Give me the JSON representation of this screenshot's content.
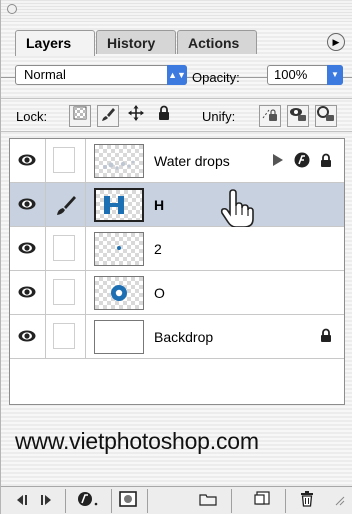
{
  "tabs": [
    {
      "label": "Layers",
      "active": true
    },
    {
      "label": "History",
      "active": false
    },
    {
      "label": "Actions",
      "active": false
    }
  ],
  "blend_mode": "Normal",
  "opacity": {
    "label": "Opacity:",
    "value": "100%"
  },
  "lock": {
    "label": "Lock:"
  },
  "unify": {
    "label": "Unify:"
  },
  "layers": [
    {
      "name": "Water drops",
      "visible": true,
      "selected": false,
      "thumb": "drops",
      "right_icons": [
        "expand-triangle-icon",
        "fx-icon",
        "lock-icon"
      ]
    },
    {
      "name": "H",
      "visible": true,
      "selected": true,
      "thumb": "H",
      "right_icons": []
    },
    {
      "name": "2",
      "visible": true,
      "selected": false,
      "thumb": "dot",
      "right_icons": []
    },
    {
      "name": "O",
      "visible": true,
      "selected": false,
      "thumb": "O",
      "right_icons": []
    },
    {
      "name": "Backdrop",
      "visible": true,
      "selected": false,
      "thumb": "white",
      "right_icons": [
        "lock-icon"
      ]
    }
  ],
  "watermark": "www.vietphotoshop.com",
  "colors": {
    "selected_row": "#c7d1df",
    "accent_blue": "#3d7ae0",
    "thumb_blue": "#1d6fb3"
  }
}
